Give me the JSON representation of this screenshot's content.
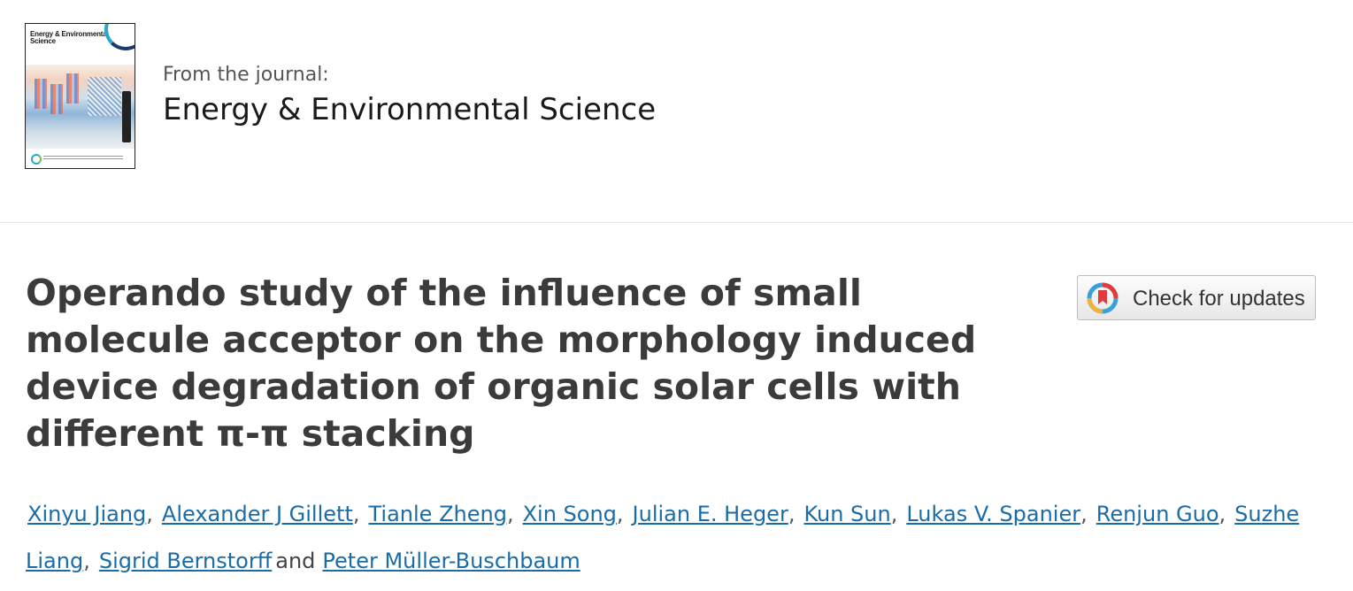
{
  "journal": {
    "from_label": "From the journal:",
    "name": "Energy & Environmental Science",
    "cover_title": "Energy & Environmental Science",
    "cover_icon": "journal-cover-image"
  },
  "article": {
    "title": "Operando study of the influence of small molecule acceptor on the morphology induced device degradation of organic solar cells with different π-π stacking"
  },
  "check_updates": {
    "label": "Check for updates",
    "icon": "crossmark-icon",
    "colors": {
      "ring_red": "#e03c3c",
      "ring_yellow": "#f2b233",
      "ring_blue": "#3aa0d8"
    }
  },
  "authors": {
    "list": [
      "Xinyu Jiang",
      "Alexander J Gillett",
      "Tianle Zheng",
      "Xin Song",
      "Julian E. Heger",
      "Kun Sun",
      "Lukas V. Spanier",
      "Renjun Guo",
      "Suzhe Liang",
      "Sigrid Bernstorff",
      "Peter Müller-Buschbaum"
    ],
    "separator": ",",
    "conjunction": "and",
    "link_color": "#1a6ca8"
  }
}
